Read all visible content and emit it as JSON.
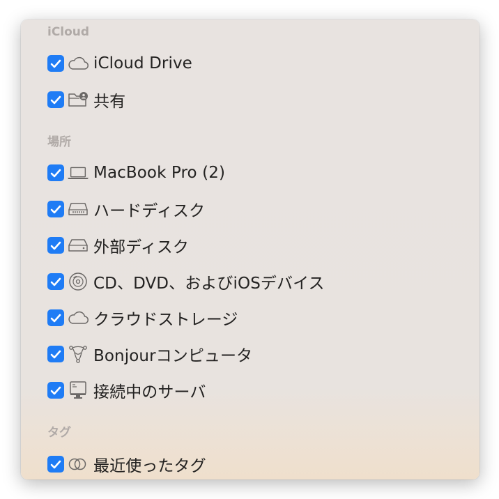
{
  "sections": [
    {
      "header": "iCloud",
      "items": [
        {
          "label": "iCloud Drive",
          "checked": true,
          "icon": "cloud-icon"
        },
        {
          "label": "共有",
          "checked": true,
          "icon": "shared-folder-icon"
        }
      ]
    },
    {
      "header": "場所",
      "items": [
        {
          "label": "MacBook Pro (2)",
          "checked": true,
          "icon": "laptop-icon"
        },
        {
          "label": "ハードディスク",
          "checked": true,
          "icon": "hard-disk-icon"
        },
        {
          "label": "外部ディスク",
          "checked": true,
          "icon": "external-disk-icon"
        },
        {
          "label": "CD、DVD、およびiOSデバイス",
          "checked": true,
          "icon": "optical-disc-icon"
        },
        {
          "label": "クラウドストレージ",
          "checked": true,
          "icon": "cloud-icon"
        },
        {
          "label": "Bonjourコンピュータ",
          "checked": true,
          "icon": "bonjour-icon"
        },
        {
          "label": "接続中のサーバ",
          "checked": true,
          "icon": "server-display-icon"
        }
      ]
    },
    {
      "header": "タグ",
      "items": [
        {
          "label": "最近使ったタグ",
          "checked": true,
          "icon": "tags-icon"
        }
      ]
    }
  ],
  "colors": {
    "checkbox_accent": "#1f7cf5",
    "section_header": "#b0aaa7",
    "label_text": "#232221",
    "icon_stroke": "#6b6866"
  }
}
